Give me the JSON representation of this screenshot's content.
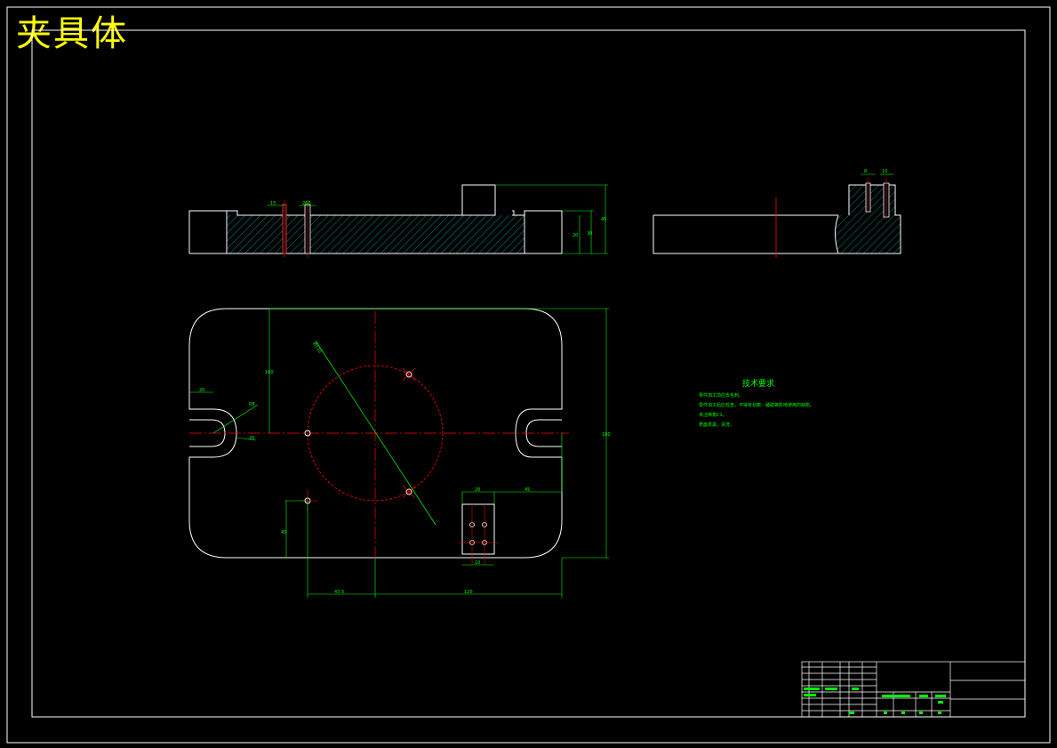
{
  "title": "夹具体",
  "colors": {
    "background": "#000000",
    "outline": "#ffffff",
    "dimension": "#00ff00",
    "centerline": "#ff0000",
    "hatch": "#00c0c0",
    "title_text": "#ffff00"
  },
  "technical_requirements": {
    "title": "技术要求",
    "lines": [
      "零件加工前应去毛刺。",
      "零件加工后应检查，不得有划痕、磕碰等影响使用的缺陷。",
      "未注倒角C1。",
      "表面发黑，清洗。"
    ]
  },
  "dimensions": {
    "front_width": "260",
    "front_side_left": "15",
    "front_height_a": "20",
    "front_height_b": "30",
    "front_height_c": "45",
    "right_slot_a": "8",
    "right_slot_b": "10",
    "top_height": "160",
    "diameter": "Ø110",
    "slot_left": "20",
    "slot_radius": "R8",
    "slot_depth": "20",
    "right_height": "160",
    "bottom_left": "45",
    "block_width": "20",
    "block_right": "45",
    "block_bottom": "10",
    "bottom_dim_a": "43.5",
    "bottom_dim_b": "120"
  }
}
